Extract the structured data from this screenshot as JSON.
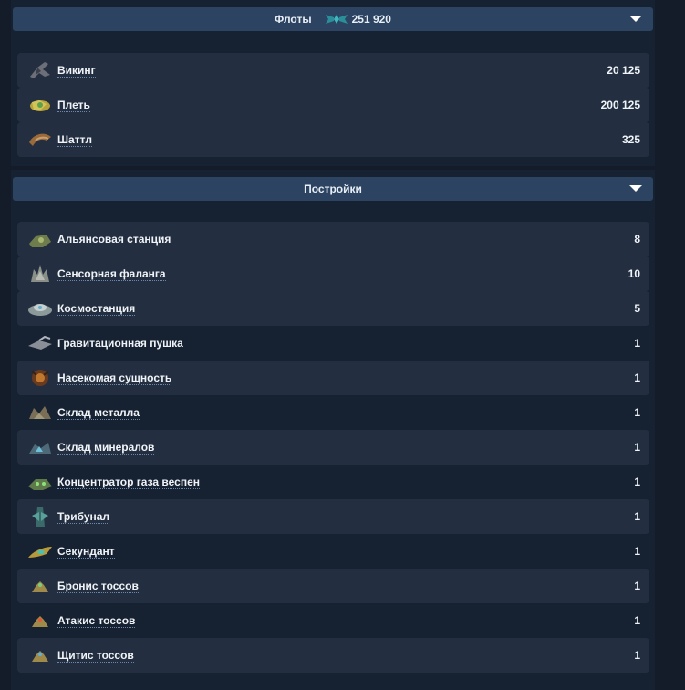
{
  "fleets": {
    "title": "Флоты",
    "total": "251 920",
    "icon": "wings-emblem-icon",
    "accent": "#3fb8c0",
    "items": [
      {
        "name": "Викинг",
        "count": "20 125",
        "icon": "viking-ship-icon"
      },
      {
        "name": "Плеть",
        "count": "200 125",
        "icon": "scourge-ship-icon"
      },
      {
        "name": "Шаттл",
        "count": "325",
        "icon": "shuttle-ship-icon"
      }
    ]
  },
  "buildings": {
    "title": "Постройки",
    "items": [
      {
        "name": "Альянсовая станция",
        "count": "8",
        "icon": "alliance-station-icon"
      },
      {
        "name": "Сенсорная фаланга",
        "count": "10",
        "icon": "sensor-phalanx-icon"
      },
      {
        "name": "Космостанция",
        "count": "5",
        "icon": "space-station-icon"
      },
      {
        "name": "Гравитационная пушка",
        "count": "1",
        "icon": "gravity-cannon-icon"
      },
      {
        "name": "Насекомая сущность",
        "count": "1",
        "icon": "insect-entity-icon"
      },
      {
        "name": "Склад металла",
        "count": "1",
        "icon": "metal-storage-icon"
      },
      {
        "name": "Склад минералов",
        "count": "1",
        "icon": "mineral-storage-icon"
      },
      {
        "name": "Концентратор газа веспен",
        "count": "1",
        "icon": "vespene-concentrator-icon"
      },
      {
        "name": "Трибунал",
        "count": "1",
        "icon": "tribunal-icon"
      },
      {
        "name": "Секундант",
        "count": "1",
        "icon": "second-icon"
      },
      {
        "name": "Бронис тоссов",
        "count": "1",
        "icon": "protoss-armor-icon"
      },
      {
        "name": "Атакис тоссов",
        "count": "1",
        "icon": "protoss-attack-icon"
      },
      {
        "name": "Щитис тоссов",
        "count": "1",
        "icon": "protoss-shield-icon"
      }
    ]
  }
}
